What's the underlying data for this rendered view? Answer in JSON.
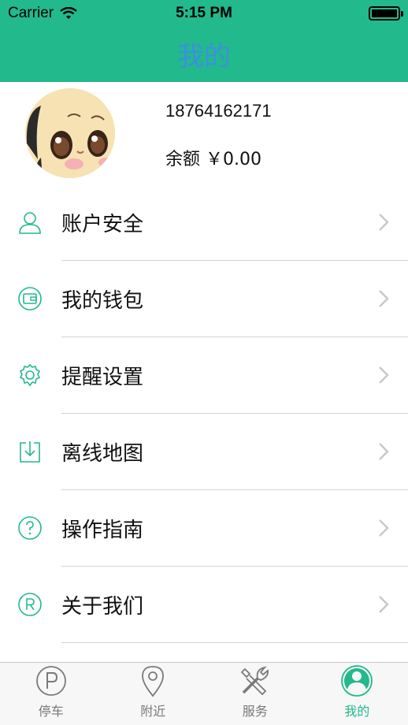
{
  "status_bar": {
    "carrier": "Carrier",
    "time": "5:15 PM"
  },
  "nav": {
    "title": "我的"
  },
  "profile": {
    "phone": "18764162171",
    "balance": "余额 ￥0.00"
  },
  "menu": [
    {
      "label": "账户安全",
      "icon": "user-icon"
    },
    {
      "label": "我的钱包",
      "icon": "wallet-icon"
    },
    {
      "label": "提醒设置",
      "icon": "gear-icon"
    },
    {
      "label": "离线地图",
      "icon": "download-icon"
    },
    {
      "label": "操作指南",
      "icon": "question-icon"
    },
    {
      "label": "关于我们",
      "icon": "registered-icon"
    }
  ],
  "tabs": [
    {
      "label": "停车",
      "icon": "parking-icon",
      "active": false
    },
    {
      "label": "附近",
      "icon": "location-pin-icon",
      "active": false
    },
    {
      "label": "服务",
      "icon": "tools-icon",
      "active": false
    },
    {
      "label": "我的",
      "icon": "profile-icon",
      "active": true
    }
  ],
  "colors": {
    "accent": "#22b98c",
    "title": "#3d8fe0",
    "divider": "#d4d4d4"
  }
}
